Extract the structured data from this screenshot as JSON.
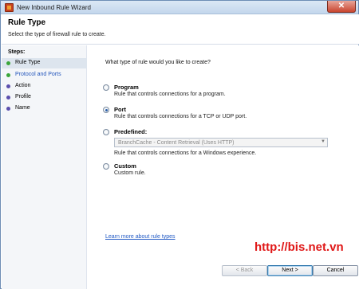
{
  "window": {
    "title": "New Inbound Rule Wizard",
    "close_glyph": "✕"
  },
  "header": {
    "title": "Rule Type",
    "description": "Select the type of firewall rule to create."
  },
  "steps": {
    "title": "Steps:",
    "items": [
      {
        "label": "Rule Type",
        "state": "current"
      },
      {
        "label": "Protocol and Ports",
        "state": "link"
      },
      {
        "label": "Action",
        "state": "pending"
      },
      {
        "label": "Profile",
        "state": "pending"
      },
      {
        "label": "Name",
        "state": "pending"
      }
    ]
  },
  "content": {
    "question": "What type of rule would you like to create?",
    "options": [
      {
        "label": "Program",
        "description": "Rule that controls connections for a program.",
        "selected": false
      },
      {
        "label": "Port",
        "description": "Rule that controls connections for a TCP or UDP port.",
        "selected": true
      },
      {
        "label": "Predefined:",
        "description": "Rule that controls connections for a Windows experience.",
        "selected": false
      },
      {
        "label": "Custom",
        "description": "Custom rule.",
        "selected": false
      }
    ],
    "predefined_select": {
      "value": "BranchCache - Content Retrieval (Uses HTTP)"
    },
    "learn_more_link": "Learn more about rule types"
  },
  "footer": {
    "back_label": "< Back",
    "next_label": "Next >",
    "cancel_label": "Cancel"
  },
  "watermark": "http://bis.net.vn",
  "colors": {
    "link": "#1f58c4",
    "watermark": "#e01818",
    "step_done": "#3aa63a",
    "step_pending": "#5b4fae"
  }
}
